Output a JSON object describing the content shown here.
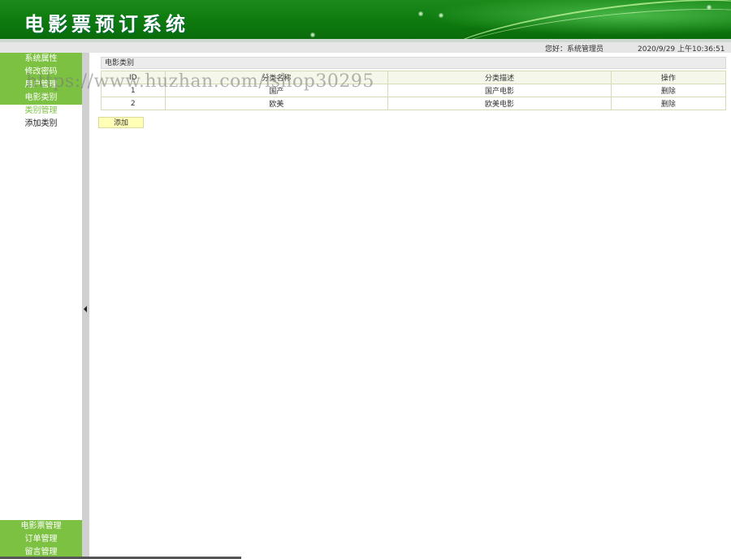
{
  "header": {
    "title": "电影票预订系统"
  },
  "status": {
    "greeting": "您好：系统管理员",
    "datetime": "2020/9/29 上午10:36:51"
  },
  "sidebar": {
    "items": [
      {
        "label": "系统属性"
      },
      {
        "label": "修改密码"
      },
      {
        "label": "用户管理"
      },
      {
        "label": "电影类别"
      },
      {
        "label": "类别管理"
      },
      {
        "label": "添加类别"
      }
    ],
    "bottom_items": [
      {
        "label": "电影票管理"
      },
      {
        "label": "订单管理"
      },
      {
        "label": "留言管理"
      }
    ]
  },
  "main": {
    "panel_title": "电影类别",
    "table": {
      "headers": [
        "ID",
        "分类名称",
        "分类描述",
        "操作"
      ],
      "rows": [
        {
          "id": "1",
          "name": "国产",
          "desc": "国产电影",
          "action": "删除"
        },
        {
          "id": "2",
          "name": "欧美",
          "desc": "欧美电影",
          "action": "删除"
        }
      ]
    },
    "add_label": "添加"
  },
  "watermark": "https://www.huzhan.com/ishop30295",
  "colors": {
    "header_green": "#0e7a0e",
    "menu_green": "#7dc143",
    "button_yellow": "#ffffb8"
  }
}
